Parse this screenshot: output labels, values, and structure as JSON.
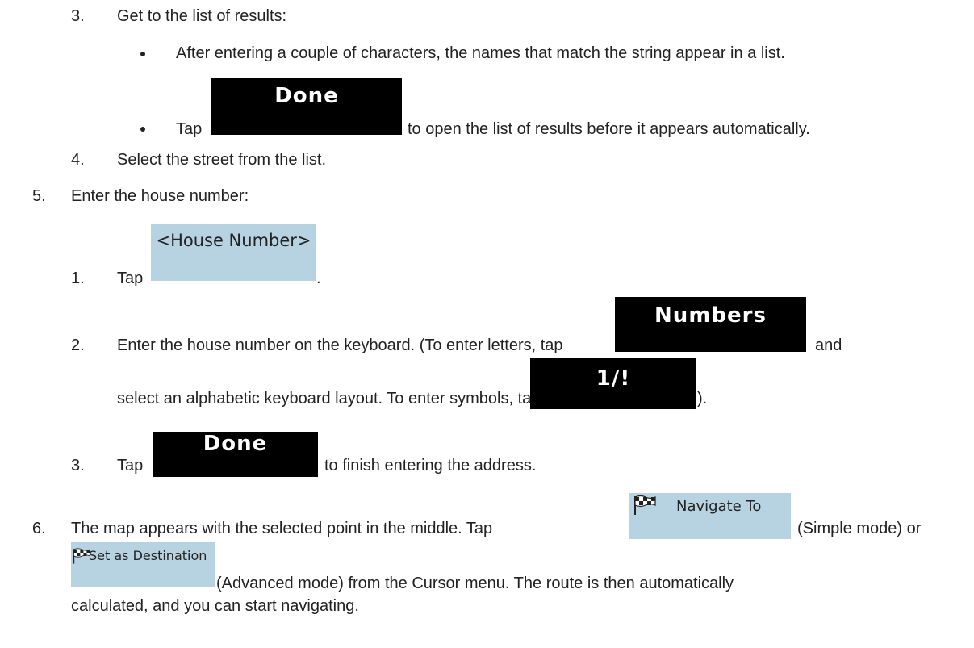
{
  "step3": {
    "num": "3.",
    "text": "Get to the list of results:",
    "bullet1": "After entering a couple of characters, the names that match the string appear in a list.",
    "bullet2_pre": "Tap",
    "done_label": "Done",
    "bullet2_post": "to open the list of results before it appears automatically."
  },
  "step4": {
    "num": "4.",
    "text": "Select the street from the list."
  },
  "step5": {
    "num": "5.",
    "text": "Enter the house number:",
    "sub1": {
      "num": "1.",
      "pre": "Tap",
      "button": "<House Number>",
      "post": "."
    },
    "sub2": {
      "num": "2.",
      "line1_pre": "Enter the house number on the keyboard. (To enter letters, tap",
      "numbers_label": "Numbers",
      "line1_post": "and",
      "line2_pre": "select an alphabetic keyboard layout. To enter symbols, tap",
      "symbols_label": "1/!",
      "line2_post": ")."
    },
    "sub3": {
      "num": "3.",
      "pre": "Tap",
      "done_label": "Done",
      "post": "to finish entering the address."
    }
  },
  "step6": {
    "num": "6.",
    "line1_pre": "The map appears with the selected point in the middle. Tap",
    "navigate_label": "Navigate To",
    "line1_post": "(Simple mode) or",
    "set_dest_label": "Set as Destination",
    "line2": "(Advanced mode) from the Cursor menu. The route is then automatically",
    "line3": "calculated, and you can start navigating."
  },
  "icons": {
    "flag": "checkered-flag-icon"
  },
  "colors": {
    "dark_button": "#000000",
    "light_button": "#b7d3e2"
  }
}
